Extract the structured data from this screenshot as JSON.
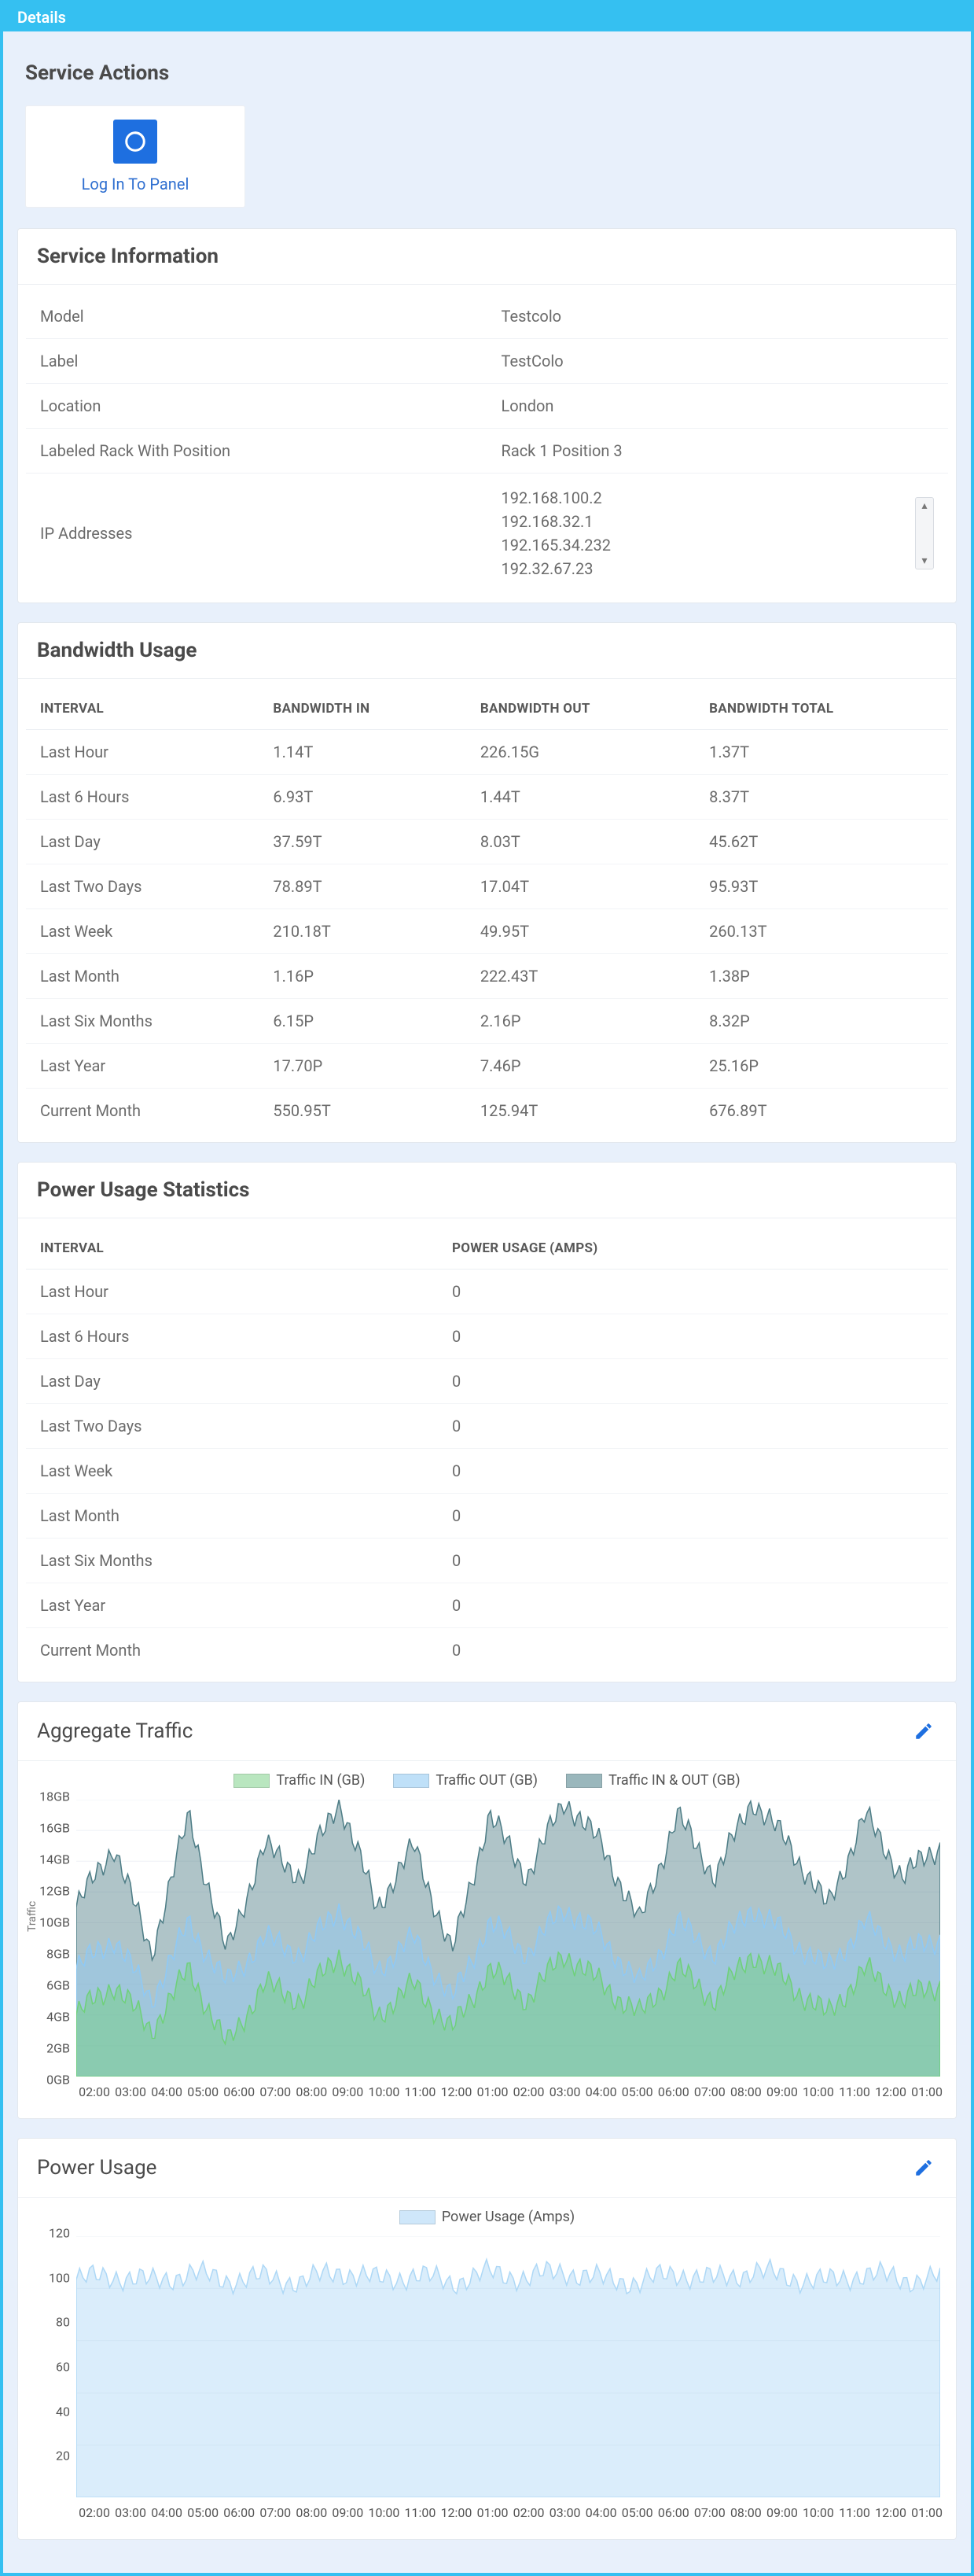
{
  "titlebar": "Details",
  "actions": {
    "heading": "Service Actions",
    "login_label": "Log In To Panel"
  },
  "service_info": {
    "heading": "Service Information",
    "rows": [
      {
        "label": "Model",
        "value": "Testcolo"
      },
      {
        "label": "Label",
        "value": "TestColo"
      },
      {
        "label": "Location",
        "value": "London"
      },
      {
        "label": "Labeled Rack With Position",
        "value": "Rack 1 Position 3"
      }
    ],
    "ip_label": "IP Addresses",
    "ip_addresses": [
      "192.168.100.2",
      "192.168.32.1",
      "192.165.34.232",
      "192.32.67.23"
    ]
  },
  "bandwidth": {
    "heading": "Bandwidth Usage",
    "columns": [
      "INTERVAL",
      "BANDWIDTH IN",
      "BANDWIDTH OUT",
      "BANDWIDTH TOTAL"
    ],
    "rows": [
      {
        "interval": "Last Hour",
        "in": "1.14T",
        "out": "226.15G",
        "total": "1.37T"
      },
      {
        "interval": "Last 6 Hours",
        "in": "6.93T",
        "out": "1.44T",
        "total": "8.37T"
      },
      {
        "interval": "Last Day",
        "in": "37.59T",
        "out": "8.03T",
        "total": "45.62T"
      },
      {
        "interval": "Last Two Days",
        "in": "78.89T",
        "out": "17.04T",
        "total": "95.93T"
      },
      {
        "interval": "Last Week",
        "in": "210.18T",
        "out": "49.95T",
        "total": "260.13T"
      },
      {
        "interval": "Last Month",
        "in": "1.16P",
        "out": "222.43T",
        "total": "1.38P"
      },
      {
        "interval": "Last Six Months",
        "in": "6.15P",
        "out": "2.16P",
        "total": "8.32P"
      },
      {
        "interval": "Last Year",
        "in": "17.70P",
        "out": "7.46P",
        "total": "25.16P"
      },
      {
        "interval": "Current Month",
        "in": "550.95T",
        "out": "125.94T",
        "total": "676.89T"
      }
    ]
  },
  "power": {
    "heading": "Power Usage Statistics",
    "columns": [
      "INTERVAL",
      "POWER USAGE (AMPS)"
    ],
    "rows": [
      {
        "interval": "Last Hour",
        "value": "0"
      },
      {
        "interval": "Last 6 Hours",
        "value": "0"
      },
      {
        "interval": "Last Day",
        "value": "0"
      },
      {
        "interval": "Last Two Days",
        "value": "0"
      },
      {
        "interval": "Last Week",
        "value": "0"
      },
      {
        "interval": "Last Month",
        "value": "0"
      },
      {
        "interval": "Last Six Months",
        "value": "0"
      },
      {
        "interval": "Last Year",
        "value": "0"
      },
      {
        "interval": "Current Month",
        "value": "0"
      }
    ]
  },
  "aggregate_traffic": {
    "heading": "Aggregate Traffic",
    "legend": {
      "in": "Traffic IN (GB)",
      "out": "Traffic OUT (GB)",
      "total": "Traffic IN & OUT (GB)"
    },
    "ylabel": "Traffic"
  },
  "power_chart": {
    "heading": "Power Usage",
    "legend": "Power Usage (Amps)"
  },
  "colors": {
    "accent": "#35c0f1",
    "link": "#2f6fd0",
    "traffic_in": "#6fd07a",
    "traffic_out": "#8fc9f5",
    "traffic_total": "#4e7d86",
    "power_fill": "#aed8f6"
  },
  "chart_data": [
    {
      "type": "area",
      "title": "Aggregate Traffic",
      "ylabel": "Traffic",
      "yticks": [
        "0GB",
        "2GB",
        "4GB",
        "6GB",
        "8GB",
        "10GB",
        "12GB",
        "14GB",
        "16GB",
        "18GB"
      ],
      "ylim": [
        0,
        18
      ],
      "xticks": [
        "02:00",
        "03:00",
        "04:00",
        "05:00",
        "06:00",
        "07:00",
        "08:00",
        "09:00",
        "10:00",
        "11:00",
        "12:00",
        "01:00",
        "02:00",
        "03:00",
        "04:00",
        "05:00",
        "06:00",
        "07:00",
        "08:00",
        "09:00",
        "10:00",
        "11:00",
        "12:00",
        "01:00"
      ],
      "legend": [
        "Traffic IN (GB)",
        "Traffic OUT (GB)",
        "Traffic IN & OUT (GB)"
      ],
      "note": "Dense noisy multi-series area; values fluctuate roughly between 0 and 18 GB per bucket. Values below are representative hourly samples read from the chart.",
      "series": [
        {
          "name": "Traffic IN (GB)",
          "color": "#6fd07a",
          "values": [
            4,
            6,
            3,
            7,
            2,
            6,
            5,
            8,
            4,
            6,
            3,
            7,
            5,
            8,
            6,
            4,
            7,
            5,
            8,
            6,
            4,
            7,
            5,
            6
          ]
        },
        {
          "name": "Traffic OUT (GB)",
          "color": "#8fc9f5",
          "values": [
            7,
            9,
            5,
            10,
            6,
            9,
            8,
            11,
            7,
            9,
            5,
            10,
            8,
            11,
            9,
            6,
            10,
            8,
            11,
            9,
            7,
            10,
            8,
            9
          ]
        },
        {
          "name": "Traffic IN & OUT (GB)",
          "color": "#4e7d86",
          "values": [
            11,
            15,
            8,
            17,
            8,
            15,
            13,
            18,
            11,
            15,
            8,
            17,
            13,
            18,
            15,
            10,
            17,
            13,
            18,
            15,
            11,
            17,
            13,
            15
          ]
        }
      ]
    },
    {
      "type": "area",
      "title": "Power Usage",
      "legend": [
        "Power Usage (Amps)"
      ],
      "yticks": [
        "20",
        "40",
        "60",
        "80",
        "100",
        "120"
      ],
      "ylim": [
        0,
        120
      ],
      "xticks": [
        "02:00",
        "03:00",
        "04:00",
        "05:00",
        "06:00",
        "07:00",
        "08:00",
        "09:00",
        "10:00",
        "11:00",
        "12:00",
        "01:00",
        "02:00",
        "03:00",
        "04:00",
        "05:00",
        "06:00",
        "07:00",
        "08:00",
        "09:00",
        "10:00",
        "11:00",
        "12:00",
        "01:00"
      ],
      "series": [
        {
          "name": "Power Usage (Amps)",
          "color": "#aed8f6",
          "values": [
            100,
            102,
            99,
            103,
            100,
            101,
            99,
            104,
            100,
            102,
            99,
            103,
            101,
            104,
            100,
            99,
            103,
            100,
            104,
            101,
            99,
            103,
            100,
            101
          ]
        }
      ]
    }
  ]
}
